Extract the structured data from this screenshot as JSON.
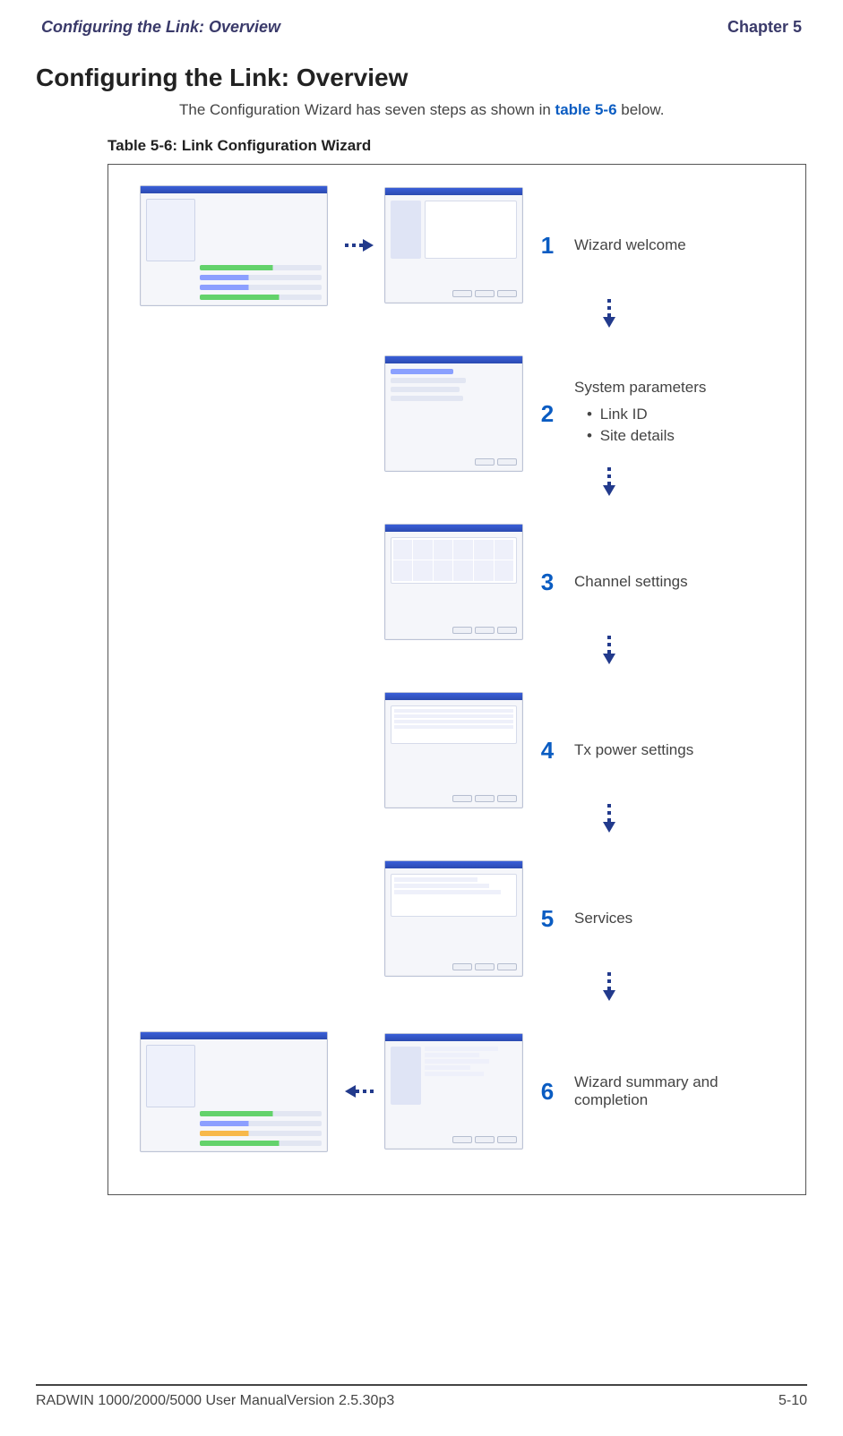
{
  "header": {
    "left": "Configuring the Link: Overview",
    "right": "Chapter 5"
  },
  "section_title": "Configuring the Link: Overview",
  "intro_prefix": "The Configuration Wizard has seven steps as shown in ",
  "intro_link": "table 5-6",
  "intro_suffix": " below.",
  "table_caption": "Table 5-6: Link Configuration Wizard",
  "steps": [
    {
      "num": "1",
      "desc": "Wizard welcome"
    },
    {
      "num": "2",
      "desc": "System parameters",
      "bullets": [
        "Link ID",
        "Site details"
      ]
    },
    {
      "num": "3",
      "desc": "Channel settings"
    },
    {
      "num": "4",
      "desc": "Tx power settings"
    },
    {
      "num": "5",
      "desc": "Services"
    },
    {
      "num": "6",
      "desc": "Wizard summary and completion"
    }
  ],
  "footer": {
    "left": "RADWIN 1000/2000/5000 User ManualVersion  2.5.30p3",
    "right": "5-10"
  }
}
